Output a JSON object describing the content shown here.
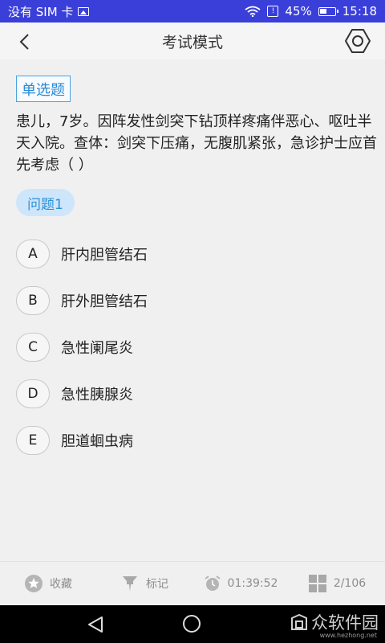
{
  "statusbar": {
    "carrier": "没有 SIM 卡",
    "battery_level": "45%",
    "time": "15:18"
  },
  "header": {
    "title": "考试模式"
  },
  "question": {
    "type_label": "单选题",
    "text": "患儿，7岁。因阵发性剑突下钻顶样疼痛伴恶心、呕吐半天入院。查体：剑突下压痛，无腹肌紧张，急诊护士应首先考虑（ ）",
    "number_label": "问题1",
    "options": [
      {
        "letter": "A",
        "text": "肝内胆管结石"
      },
      {
        "letter": "B",
        "text": "肝外胆管结石"
      },
      {
        "letter": "C",
        "text": "急性阑尾炎"
      },
      {
        "letter": "D",
        "text": "急性胰腺炎"
      },
      {
        "letter": "E",
        "text": "胆道蛔虫病"
      }
    ]
  },
  "bottombar": {
    "favorite_label": "收藏",
    "mark_label": "标记",
    "timer": "01:39:52",
    "progress": "2/106"
  },
  "watermark": {
    "text": "众软件园",
    "url": "www.hezhong.net"
  },
  "colors": {
    "statusbar_bg": "#3a3fd9",
    "accent": "#2a8ad4",
    "question_number_bg": "#cde6fb"
  }
}
